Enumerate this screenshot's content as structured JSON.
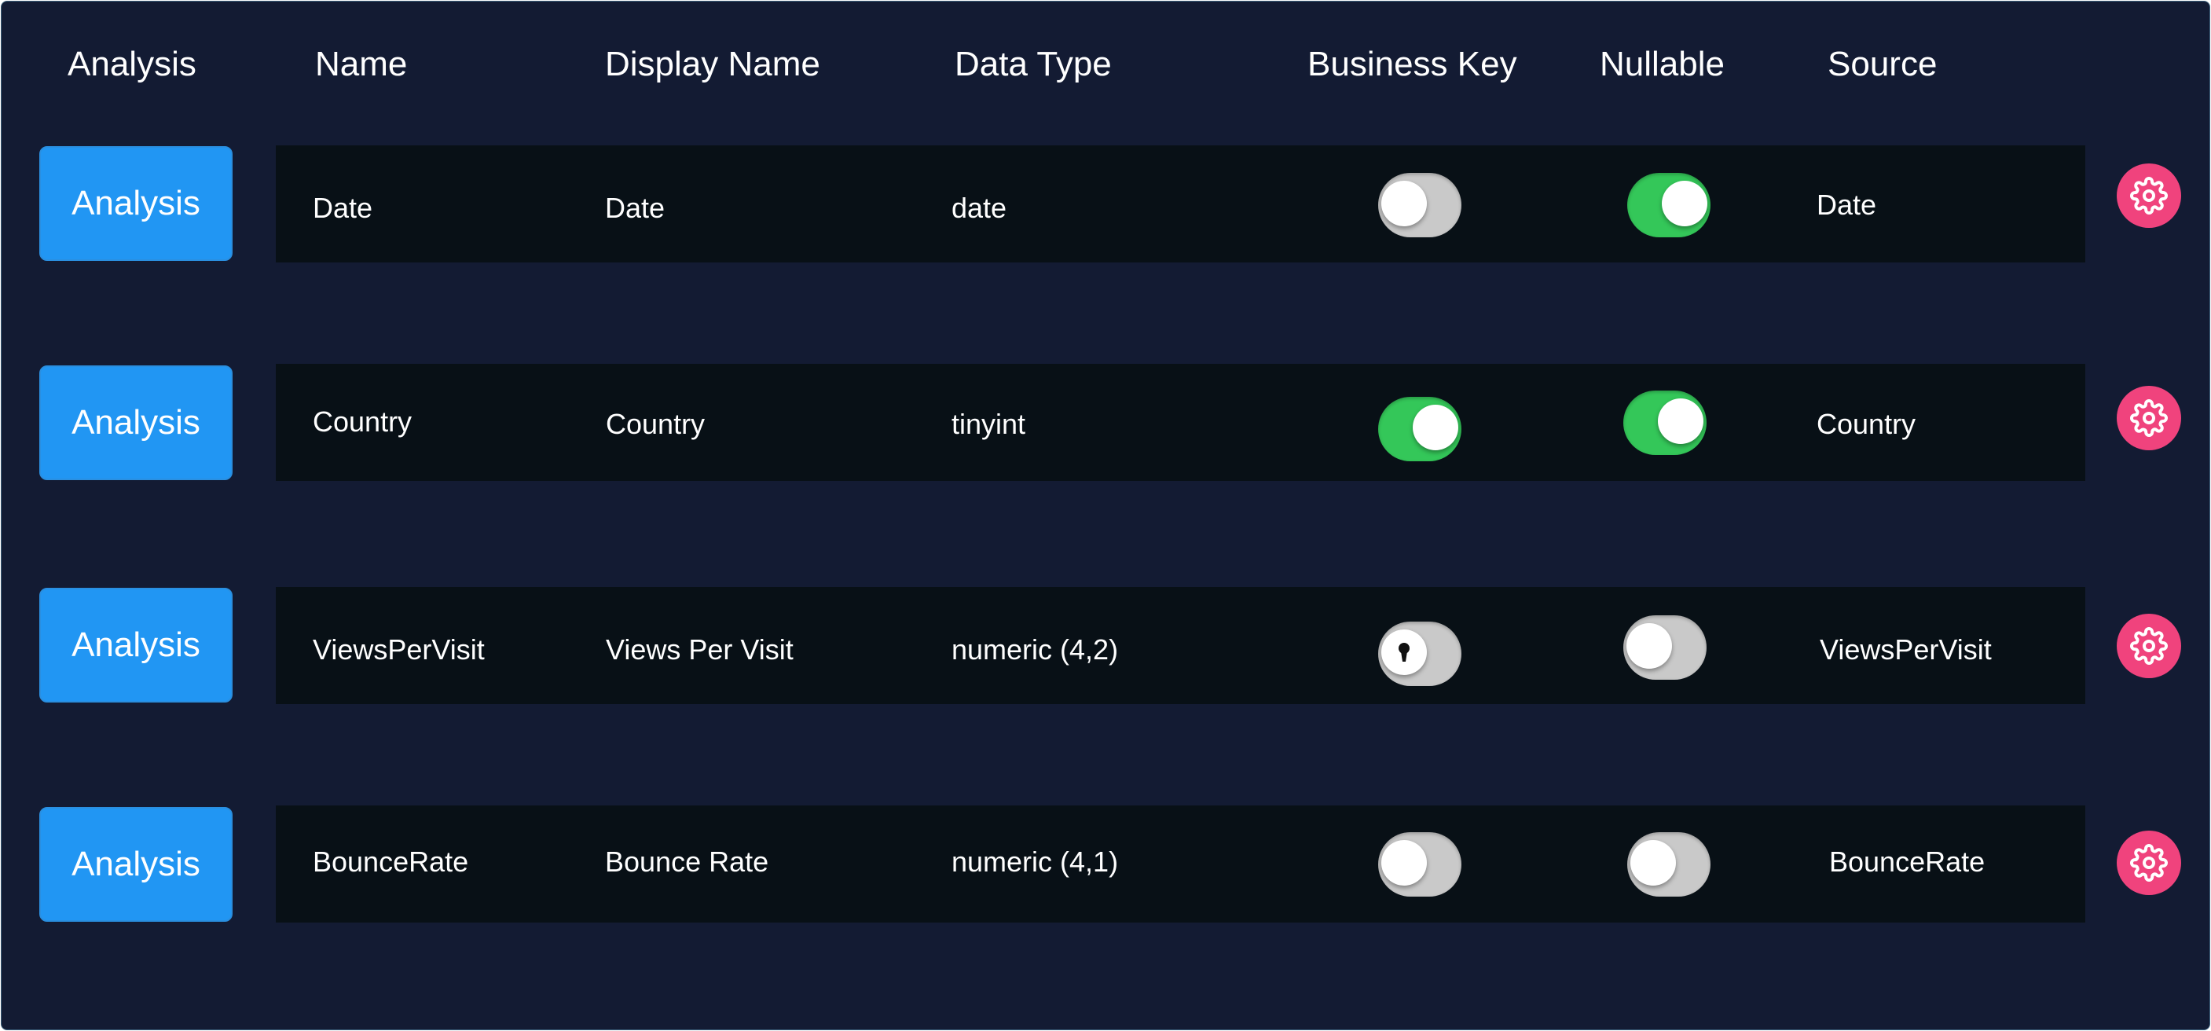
{
  "headers": {
    "analysis": "Analysis",
    "name": "Name",
    "display_name": "Display Name",
    "data_type": "Data Type",
    "business_key": "Business Key",
    "nullable": "Nullable",
    "source": "Source"
  },
  "rows": [
    {
      "button_label": "Analysis",
      "name": "Date",
      "display_name": "Date",
      "data_type": "date",
      "business_key": "off",
      "nullable": "on",
      "source": "Date"
    },
    {
      "button_label": "Analysis",
      "name": "Country",
      "display_name": "Country",
      "data_type": "tinyint",
      "business_key": "on",
      "nullable": "on",
      "source": "Country"
    },
    {
      "button_label": "Analysis",
      "name": "ViewsPerVisit",
      "display_name": "Views Per Visit",
      "data_type": "numeric (4,2)",
      "business_key": "off-locked",
      "nullable": "off",
      "source": "ViewsPerVisit"
    },
    {
      "button_label": "Analysis",
      "name": "BounceRate",
      "display_name": "Bounce Rate",
      "data_type": "numeric (4,1)",
      "business_key": "off",
      "nullable": "off",
      "source": "BounceRate"
    }
  ],
  "icons": {
    "settings": "gear-icon",
    "lock": "keyhole-icon"
  },
  "colors": {
    "background": "#131b33",
    "row_background": "#081016",
    "analysis_button": "#2196f3",
    "toggle_on": "#34c759",
    "toggle_off": "#c9c9c9",
    "settings_button": "#f0437d"
  }
}
